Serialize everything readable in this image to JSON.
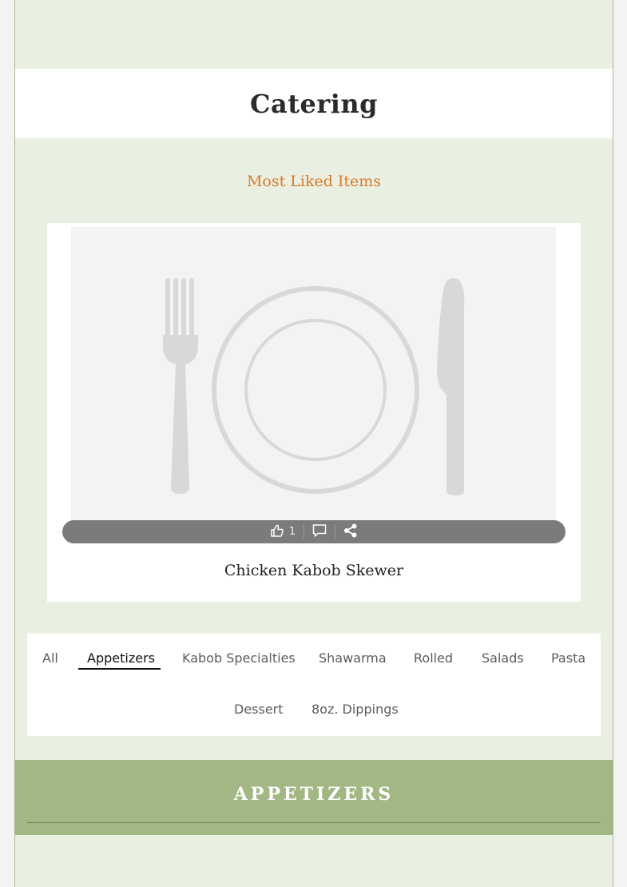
{
  "page": {
    "title": "Catering"
  },
  "most_liked": {
    "heading": "Most Liked Items",
    "item": {
      "name": "Chicken Kabob Skewer",
      "image": "plate-fork-knife-placeholder",
      "likes": "1",
      "actions": [
        "like-icon",
        "comment-icon",
        "share-icon"
      ]
    }
  },
  "categories": {
    "tabs": [
      "All",
      "Appetizers",
      "Kabob Specialties",
      "Shawarma",
      "Rolled",
      "Salads",
      "Pasta",
      "Dessert",
      "8oz. Dippings"
    ],
    "active": "Appetizers"
  },
  "section": {
    "title": "APPETIZERS"
  },
  "colors": {
    "page_background": "#eaf0e1",
    "accent_orange": "#d9782a",
    "section_band": "#a2b884",
    "action_bar": "#7b7b7b"
  }
}
